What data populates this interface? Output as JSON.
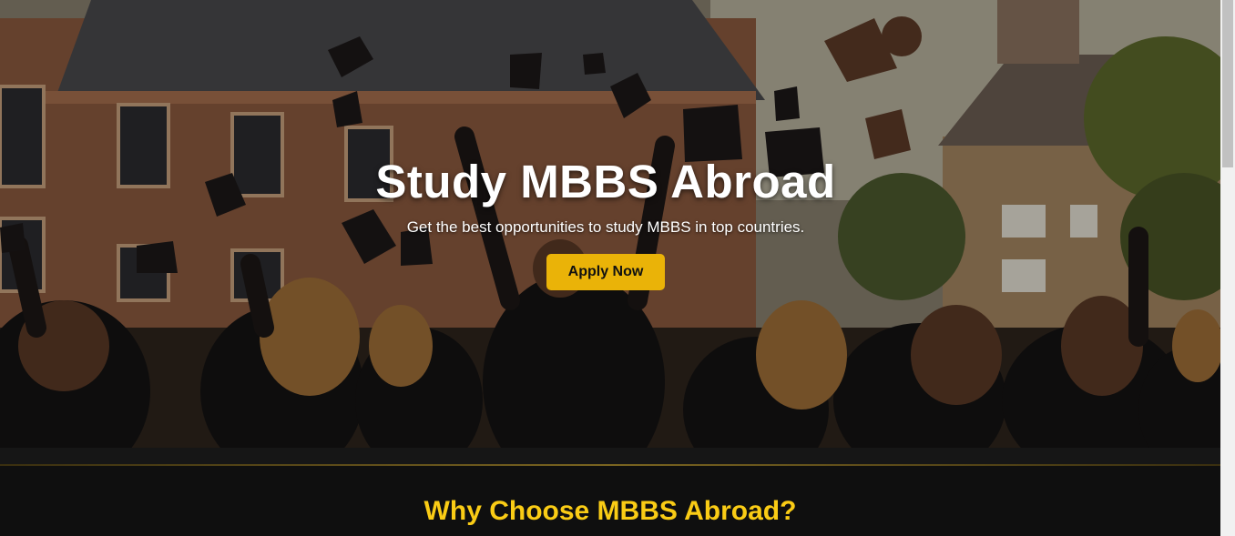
{
  "hero": {
    "title": "Study MBBS Abroad",
    "subtitle": "Get the best opportunities to study MBBS in top countries.",
    "cta_label": "Apply Now",
    "background_image": "graduates-throwing-caps-photo"
  },
  "section": {
    "title": "Why Choose MBBS Abroad?"
  },
  "colors": {
    "accent": "#eab308",
    "heading_accent": "#facc15",
    "page_background": "#0f0f0f",
    "hero_text": "#ffffff"
  }
}
